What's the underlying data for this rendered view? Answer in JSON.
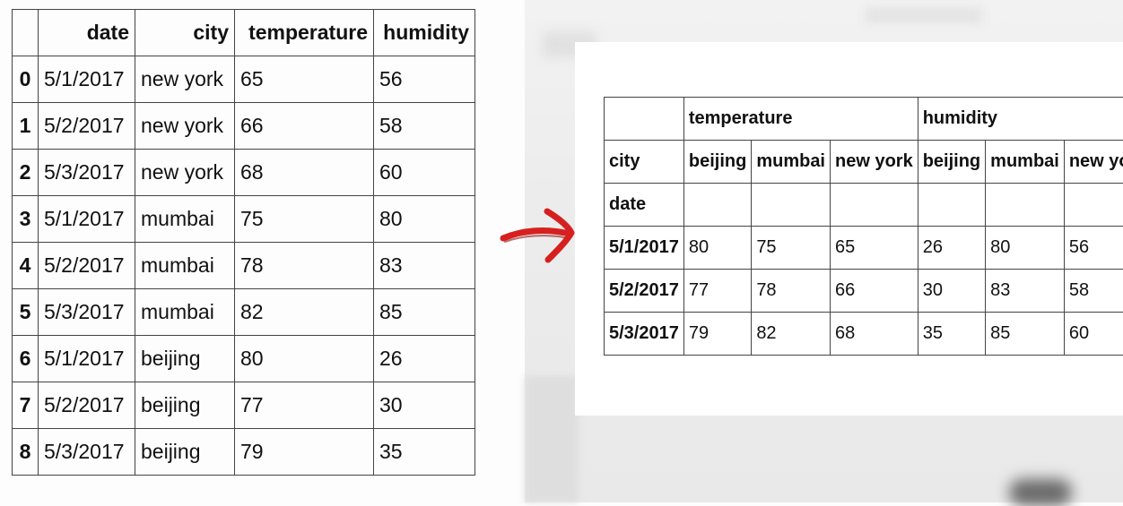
{
  "source_table": {
    "columns": [
      "",
      "date",
      "city",
      "temperature",
      "humidity"
    ],
    "rows": [
      {
        "index": "0",
        "date": "5/1/2017",
        "city": "new york",
        "temperature": "65",
        "humidity": "56"
      },
      {
        "index": "1",
        "date": "5/2/2017",
        "city": "new york",
        "temperature": "66",
        "humidity": "58"
      },
      {
        "index": "2",
        "date": "5/3/2017",
        "city": "new york",
        "temperature": "68",
        "humidity": "60"
      },
      {
        "index": "3",
        "date": "5/1/2017",
        "city": "mumbai",
        "temperature": "75",
        "humidity": "80"
      },
      {
        "index": "4",
        "date": "5/2/2017",
        "city": "mumbai",
        "temperature": "78",
        "humidity": "83"
      },
      {
        "index": "5",
        "date": "5/3/2017",
        "city": "mumbai",
        "temperature": "82",
        "humidity": "85"
      },
      {
        "index": "6",
        "date": "5/1/2017",
        "city": "beijing",
        "temperature": "80",
        "humidity": "26"
      },
      {
        "index": "7",
        "date": "5/2/2017",
        "city": "beijing",
        "temperature": "77",
        "humidity": "30"
      },
      {
        "index": "8",
        "date": "5/3/2017",
        "city": "beijing",
        "temperature": "79",
        "humidity": "35"
      }
    ]
  },
  "arrow": {
    "icon": "right-arrow-icon",
    "color": "#d62020"
  },
  "pivot_table": {
    "group_headers": [
      "temperature",
      "humidity"
    ],
    "columns_label": "city",
    "sub_headers": [
      "beijing",
      "mumbai",
      "new york",
      "beijing",
      "mumbai",
      "new york"
    ],
    "index_label": "date",
    "rows": [
      {
        "date": "5/1/2017",
        "values": [
          "80",
          "75",
          "65",
          "26",
          "80",
          "56"
        ]
      },
      {
        "date": "5/2/2017",
        "values": [
          "77",
          "78",
          "66",
          "30",
          "83",
          "58"
        ]
      },
      {
        "date": "5/3/2017",
        "values": [
          "79",
          "82",
          "68",
          "35",
          "85",
          "60"
        ]
      }
    ]
  }
}
